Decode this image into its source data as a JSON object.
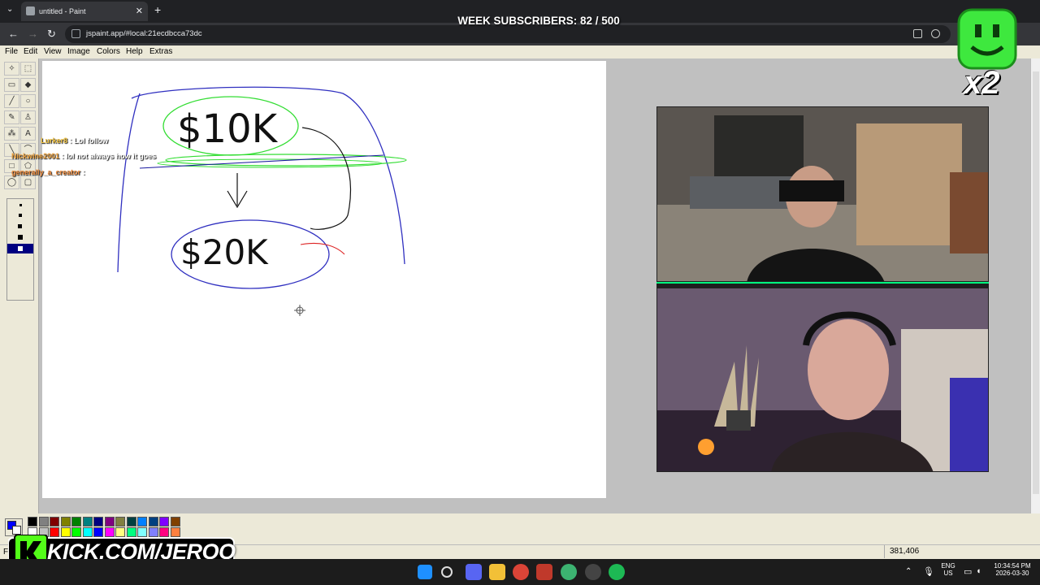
{
  "browser": {
    "tab_title": "untitled - Paint",
    "url": "jspaint.app/#local:21ecdbcca73dc"
  },
  "overlay": {
    "subscribers": "WEEK SUBSCRIBERS: 82 / 500",
    "logo_multiplier": "x2",
    "kick_url": "KICK.COM/JERQO"
  },
  "paint": {
    "menu": [
      "File",
      "Edit",
      "View",
      "Image",
      "Colors",
      "Help",
      "Extras"
    ],
    "status_left": "Fo",
    "coordinates": "381,406",
    "palette": [
      "#000000",
      "#808080",
      "#800000",
      "#808000",
      "#008000",
      "#008080",
      "#000080",
      "#800080",
      "#808040",
      "#004040",
      "#0080ff",
      "#004080",
      "#8000ff",
      "#804000",
      "#ffffff",
      "#c0c0c0",
      "#ff0000",
      "#ffff00",
      "#00ff00",
      "#00ffff",
      "#0000ff",
      "#ff00ff",
      "#ffff80",
      "#00ff80",
      "#80ffff",
      "#8080ff",
      "#ff0080",
      "#ff8040"
    ],
    "primary_color": "#0000ff",
    "secondary_color": "#ffffff"
  },
  "drawing": {
    "top_text": "$10K",
    "bottom_text": "$20K"
  },
  "chat": [
    {
      "user": "Lurker8",
      "message": ": Lol follow",
      "color": "#f4c542"
    },
    {
      "user": "Nickwine2001",
      "message": ": lol not always how it goes",
      "color": "#f4a742"
    },
    {
      "user": "generally_a_creator",
      "message": ":",
      "color": "#f08c3c"
    }
  ],
  "taskbar": {
    "lang_top": "ENG",
    "lang_bottom": "US",
    "time": "10:34:54 PM",
    "date": "2026-03-30"
  }
}
